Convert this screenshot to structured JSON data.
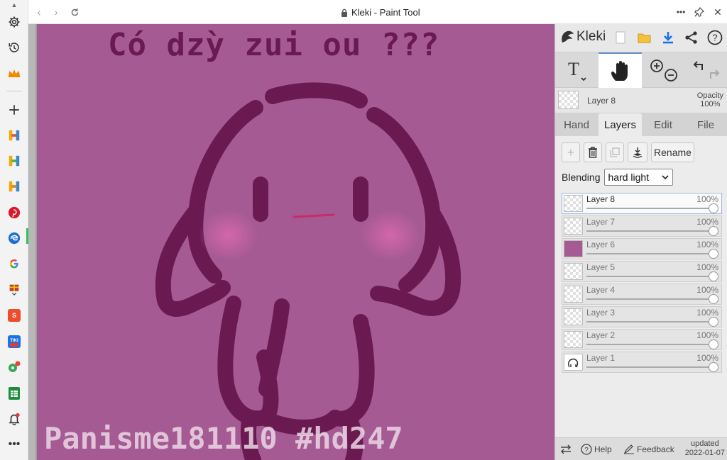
{
  "window": {
    "title": "Kleki - Paint Tool"
  },
  "browser_sidebar": {
    "items": [
      "settings-icon",
      "history-icon",
      "crown-icon",
      "add-icon",
      "h-app-icon",
      "h-app-icon",
      "h-app-icon",
      "pinterest-icon",
      "edge-icon",
      "google-icon",
      "gift-icon",
      "shopee-icon",
      "tiki-icon",
      "maps-icon",
      "sheets-icon",
      "bell-icon",
      "more-icon"
    ],
    "tiki_label": "TIKI"
  },
  "canvas": {
    "caption": "Có dzỳ zui ou ???",
    "signature": "Panisme181110 #hd247",
    "bg_color": "#a55a94",
    "stroke_color": "#6a1a50"
  },
  "panel": {
    "brand": "Kleki",
    "current_layer": {
      "name": "Layer 8",
      "opacity_label": "Opacity",
      "opacity_value": "100%"
    },
    "tabs": [
      {
        "label": "Hand",
        "active": false
      },
      {
        "label": "Layers",
        "active": true
      },
      {
        "label": "Edit",
        "active": false
      },
      {
        "label": "File",
        "active": false
      }
    ],
    "layer_buttons": {
      "rename": "Rename"
    },
    "blending": {
      "label": "Blending",
      "value": "hard light"
    },
    "layers": [
      {
        "name": "Layer 8",
        "opacity": "100%",
        "selected": true
      },
      {
        "name": "Layer 7",
        "opacity": "100%",
        "selected": false
      },
      {
        "name": "Layer 6",
        "opacity": "100%",
        "selected": false
      },
      {
        "name": "Layer 5",
        "opacity": "100%",
        "selected": false
      },
      {
        "name": "Layer 4",
        "opacity": "100%",
        "selected": false
      },
      {
        "name": "Layer 3",
        "opacity": "100%",
        "selected": false
      },
      {
        "name": "Layer 2",
        "opacity": "100%",
        "selected": false
      },
      {
        "name": "Layer 1",
        "opacity": "100%",
        "selected": false
      }
    ],
    "footer": {
      "help": "Help",
      "feedback": "Feedback",
      "updated_label": "updated",
      "updated_date": "2022-01-07"
    }
  }
}
